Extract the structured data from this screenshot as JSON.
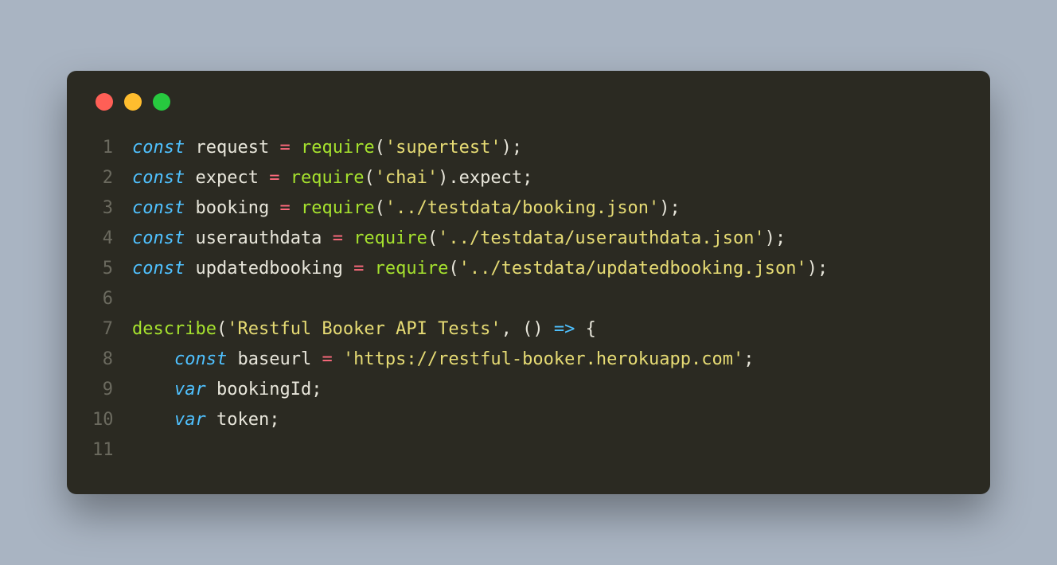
{
  "window": {
    "traffic_lights": [
      "red",
      "yellow",
      "green"
    ]
  },
  "code": {
    "lines": [
      {
        "num": "1",
        "tokens": [
          {
            "cls": "kw",
            "t": "const"
          },
          {
            "cls": "punct",
            "t": " "
          },
          {
            "cls": "ident",
            "t": "request"
          },
          {
            "cls": "punct",
            "t": " "
          },
          {
            "cls": "op",
            "t": "="
          },
          {
            "cls": "punct",
            "t": " "
          },
          {
            "cls": "func",
            "t": "require"
          },
          {
            "cls": "punct",
            "t": "("
          },
          {
            "cls": "str",
            "t": "'supertest'"
          },
          {
            "cls": "punct",
            "t": ");"
          }
        ]
      },
      {
        "num": "2",
        "tokens": [
          {
            "cls": "kw",
            "t": "const"
          },
          {
            "cls": "punct",
            "t": " "
          },
          {
            "cls": "ident",
            "t": "expect"
          },
          {
            "cls": "punct",
            "t": " "
          },
          {
            "cls": "op",
            "t": "="
          },
          {
            "cls": "punct",
            "t": " "
          },
          {
            "cls": "func",
            "t": "require"
          },
          {
            "cls": "punct",
            "t": "("
          },
          {
            "cls": "str",
            "t": "'chai'"
          },
          {
            "cls": "punct",
            "t": ")."
          },
          {
            "cls": "ident",
            "t": "expect"
          },
          {
            "cls": "punct",
            "t": ";"
          }
        ]
      },
      {
        "num": "3",
        "tokens": [
          {
            "cls": "kw",
            "t": "const"
          },
          {
            "cls": "punct",
            "t": " "
          },
          {
            "cls": "ident",
            "t": "booking"
          },
          {
            "cls": "punct",
            "t": " "
          },
          {
            "cls": "op",
            "t": "="
          },
          {
            "cls": "punct",
            "t": " "
          },
          {
            "cls": "func",
            "t": "require"
          },
          {
            "cls": "punct",
            "t": "("
          },
          {
            "cls": "str",
            "t": "'../testdata/booking.json'"
          },
          {
            "cls": "punct",
            "t": ");"
          }
        ]
      },
      {
        "num": "4",
        "tokens": [
          {
            "cls": "kw",
            "t": "const"
          },
          {
            "cls": "punct",
            "t": " "
          },
          {
            "cls": "ident",
            "t": "userauthdata"
          },
          {
            "cls": "punct",
            "t": " "
          },
          {
            "cls": "op",
            "t": "="
          },
          {
            "cls": "punct",
            "t": " "
          },
          {
            "cls": "func",
            "t": "require"
          },
          {
            "cls": "punct",
            "t": "("
          },
          {
            "cls": "str",
            "t": "'../testdata/userauthdata.json'"
          },
          {
            "cls": "punct",
            "t": ");"
          }
        ]
      },
      {
        "num": "5",
        "tokens": [
          {
            "cls": "kw",
            "t": "const"
          },
          {
            "cls": "punct",
            "t": " "
          },
          {
            "cls": "ident",
            "t": "updatedbooking"
          },
          {
            "cls": "punct",
            "t": " "
          },
          {
            "cls": "op",
            "t": "="
          },
          {
            "cls": "punct",
            "t": " "
          },
          {
            "cls": "func",
            "t": "require"
          },
          {
            "cls": "punct",
            "t": "("
          },
          {
            "cls": "str",
            "t": "'../testdata/updatedbooking.json'"
          },
          {
            "cls": "punct",
            "t": ");"
          }
        ]
      },
      {
        "num": "6",
        "tokens": []
      },
      {
        "num": "7",
        "tokens": [
          {
            "cls": "func",
            "t": "describe"
          },
          {
            "cls": "punct",
            "t": "("
          },
          {
            "cls": "str",
            "t": "'Restful Booker API Tests'"
          },
          {
            "cls": "punct",
            "t": ", () "
          },
          {
            "cls": "arrow",
            "t": "=>"
          },
          {
            "cls": "punct",
            "t": " {"
          }
        ]
      },
      {
        "num": "8",
        "tokens": [
          {
            "cls": "punct",
            "t": "    "
          },
          {
            "cls": "kw",
            "t": "const"
          },
          {
            "cls": "punct",
            "t": " "
          },
          {
            "cls": "ident",
            "t": "baseurl"
          },
          {
            "cls": "punct",
            "t": " "
          },
          {
            "cls": "op",
            "t": "="
          },
          {
            "cls": "punct",
            "t": " "
          },
          {
            "cls": "str",
            "t": "'https://restful-booker.herokuapp.com'"
          },
          {
            "cls": "punct",
            "t": ";"
          }
        ]
      },
      {
        "num": "9",
        "tokens": [
          {
            "cls": "punct",
            "t": "    "
          },
          {
            "cls": "kw",
            "t": "var"
          },
          {
            "cls": "punct",
            "t": " "
          },
          {
            "cls": "ident",
            "t": "bookingId"
          },
          {
            "cls": "punct",
            "t": ";"
          }
        ]
      },
      {
        "num": "10",
        "tokens": [
          {
            "cls": "punct",
            "t": "    "
          },
          {
            "cls": "kw",
            "t": "var"
          },
          {
            "cls": "punct",
            "t": " "
          },
          {
            "cls": "ident",
            "t": "token"
          },
          {
            "cls": "punct",
            "t": ";"
          }
        ]
      },
      {
        "num": "11",
        "tokens": []
      }
    ]
  }
}
